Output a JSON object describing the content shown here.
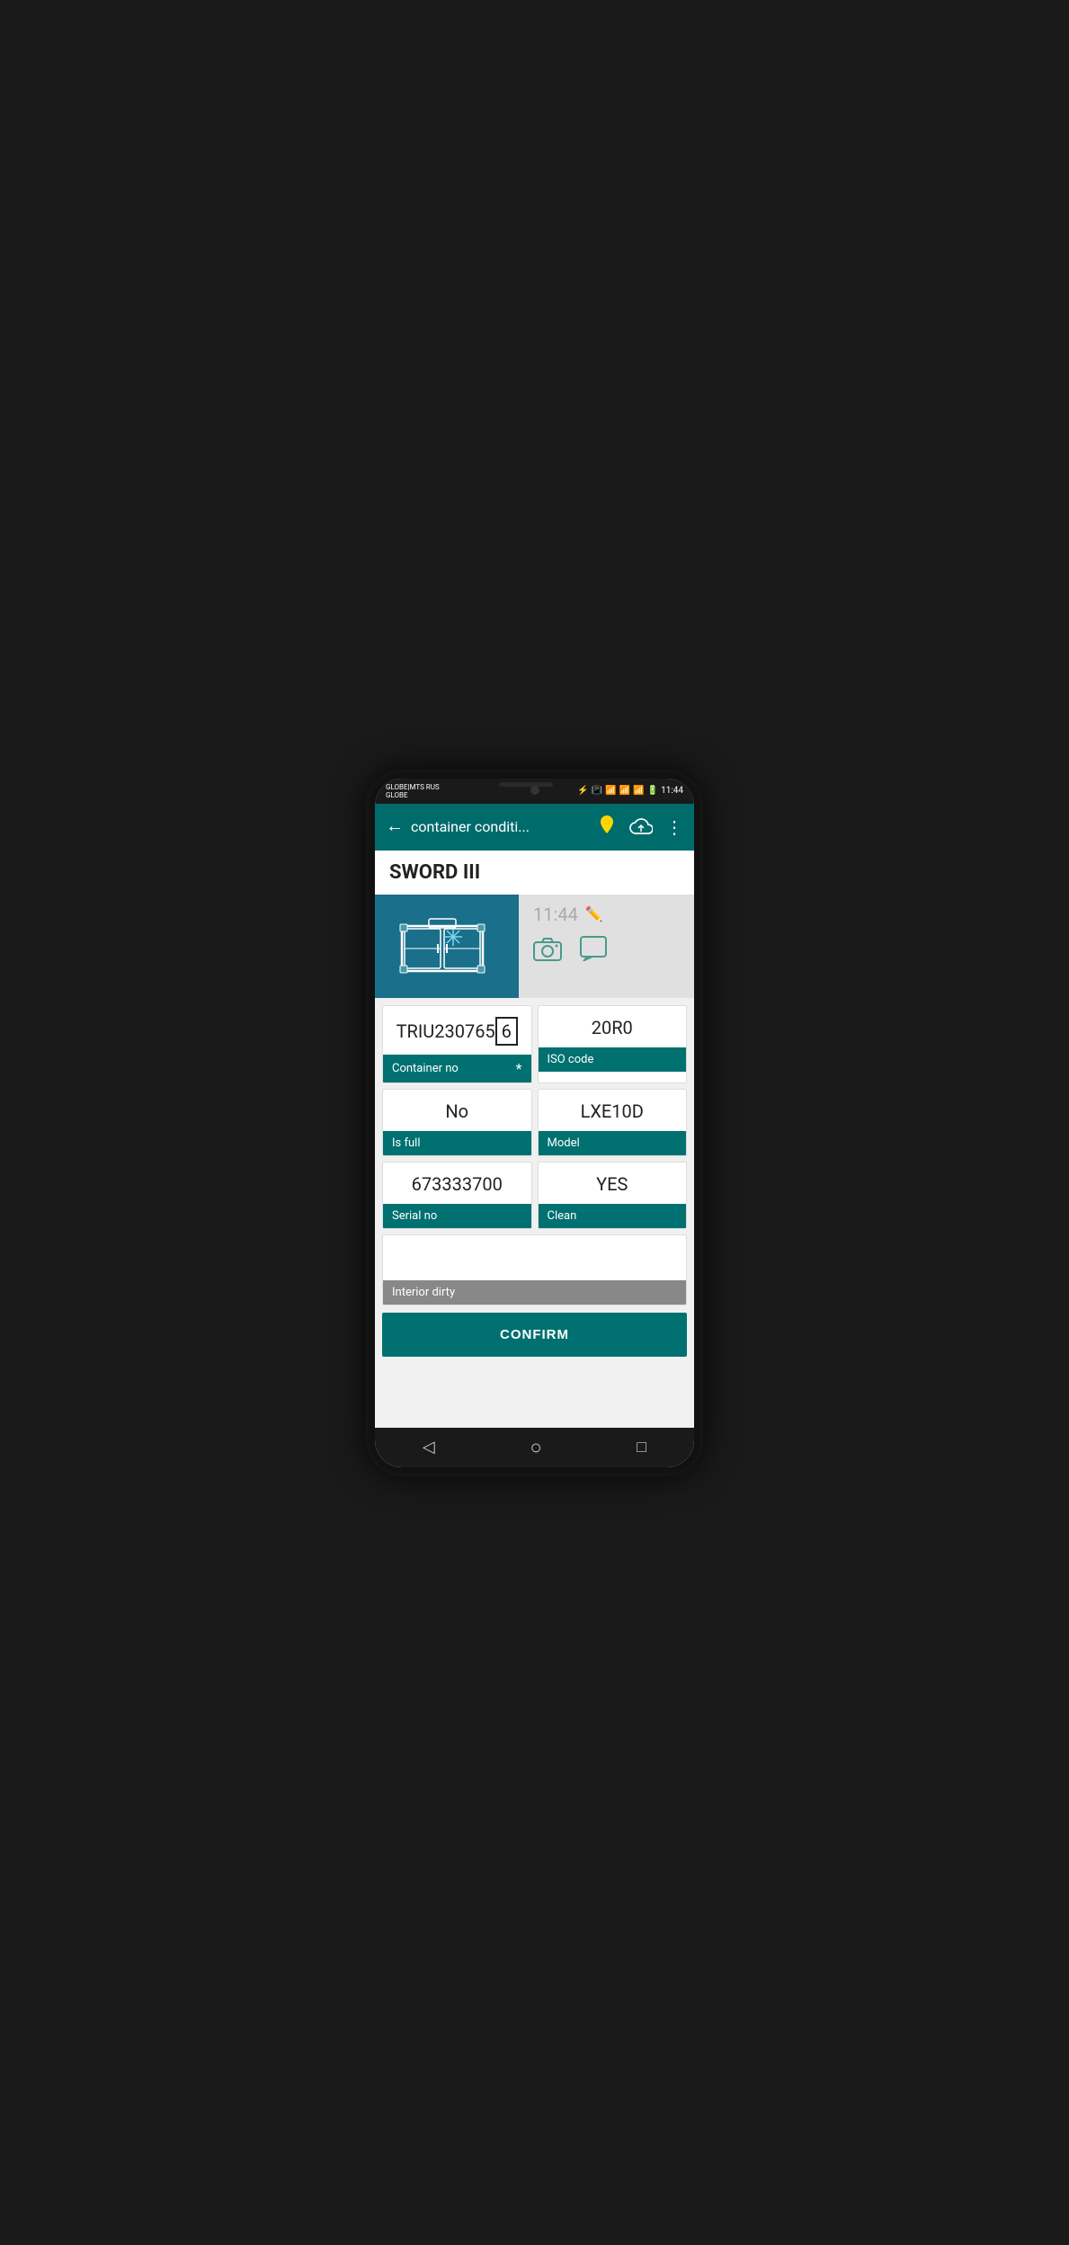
{
  "status_bar": {
    "carrier": "GLOBE|MTS RUS",
    "carrier2": "GLOBE",
    "time": "11:44",
    "battery": "100"
  },
  "app_bar": {
    "title": "container conditi...",
    "back_label": "←",
    "menu_label": "⋮"
  },
  "page": {
    "title": "SWORD III",
    "time_value": "11:44"
  },
  "fields": {
    "container_no_value": "TRIU230765",
    "container_no_check": "6",
    "container_no_label": "Container no",
    "container_no_asterisk": "*",
    "iso_code_value": "20R0",
    "iso_code_label": "ISO code",
    "is_full_value": "No",
    "is_full_label": "Is full",
    "model_value": "LXE10D",
    "model_label": "Model",
    "serial_no_value": "673333700",
    "serial_no_label": "Serial no",
    "clean_value": "YES",
    "clean_label": "Clean",
    "interior_dirty_value": "",
    "interior_dirty_label": "Interior dirty"
  },
  "buttons": {
    "confirm": "CONFIRM"
  },
  "nav": {
    "back": "◁",
    "home": "○",
    "recent": "□"
  }
}
